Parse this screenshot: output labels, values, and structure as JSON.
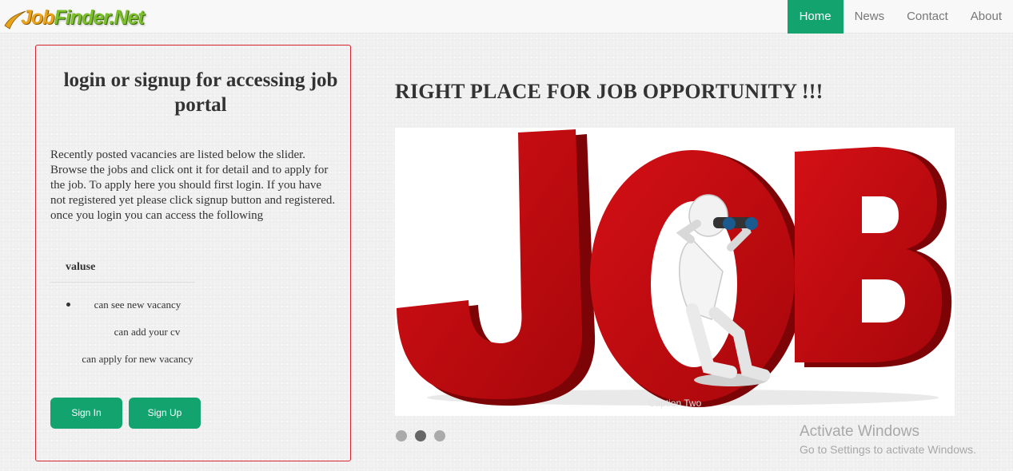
{
  "brand": {
    "logo_text_part1": "Job",
    "logo_text_part2": "Finder.Net"
  },
  "nav": {
    "items": [
      "Home",
      "News",
      "Contact",
      "About"
    ],
    "active": "Home"
  },
  "login_panel": {
    "title": "login or signup for accessing job portal",
    "description": "Recently posted vacancies are listed below the slider. Browse the jobs and click ont it for detail and to apply for the job. To apply here you should first login. If you have not registered yet please click signup button and registered. once you login you can access the following",
    "values_heading": "valuse",
    "values": [
      "can see new vacancy",
      "can add your cv",
      "can apply for new vacancy"
    ],
    "signin_label": "Sign In",
    "signup_label": "Sign Up"
  },
  "hero": {
    "title": "RIGHT PLACE FOR JOB OPPORTUNITY !!!",
    "slide_caption": "Caption Two",
    "slide_count": 3,
    "active_slide": 2
  },
  "watermark": {
    "title": "Activate Windows",
    "subtitle": "Go to Settings to activate Windows."
  },
  "colors": {
    "accent": "#12a36f",
    "panel_border": "#d9232e",
    "job_red": "#b3080c"
  }
}
